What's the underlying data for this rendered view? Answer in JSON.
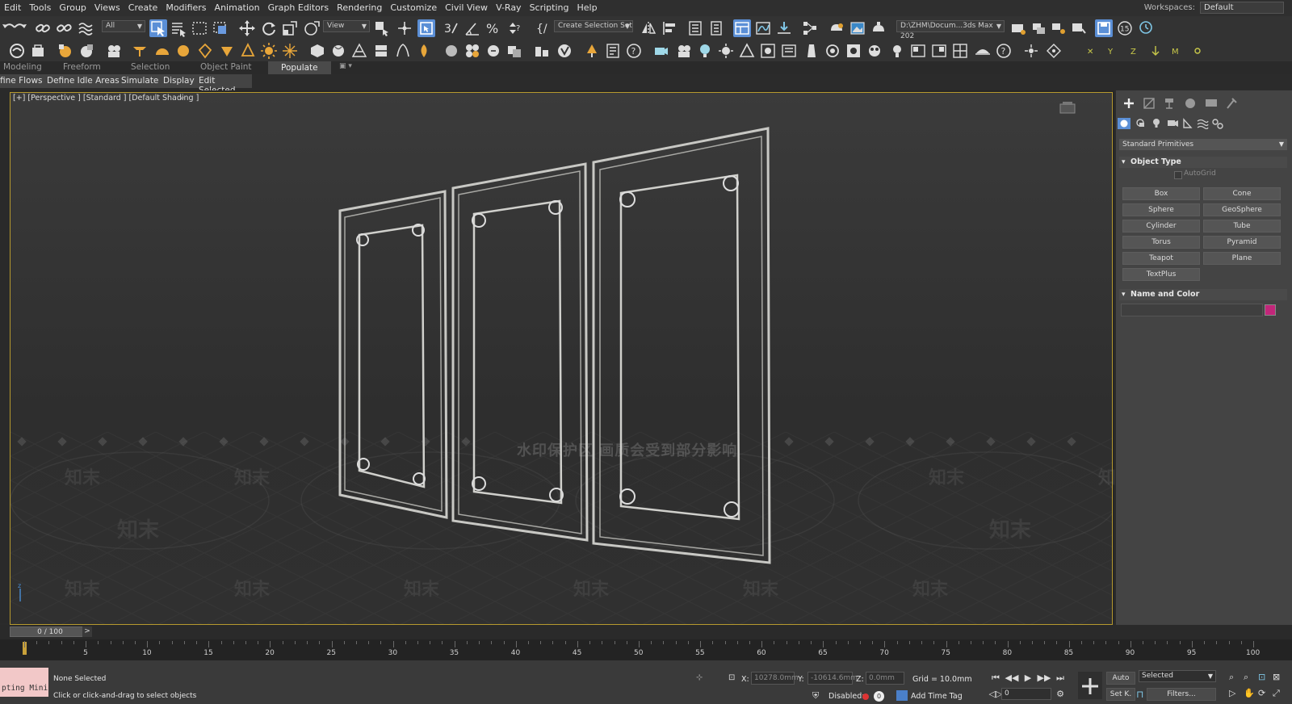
{
  "menu": [
    "Edit",
    "Tools",
    "Group",
    "Views",
    "Create",
    "Modifiers",
    "Animation",
    "Graph Editors",
    "Rendering",
    "Customize",
    "Civil View",
    "V-Ray",
    "Scripting",
    "Help"
  ],
  "workspaces": {
    "label": "Workspaces:",
    "value": "Default"
  },
  "toolbar": {
    "selection_filter": "All",
    "ref_coord": "View",
    "selection_set": "Create Selection Set",
    "project_path": "D:\\ZHM\\Docum...3ds Max 202",
    "snap_counter": "15"
  },
  "ribbon": {
    "tabs": [
      "Modeling",
      "Freeform",
      "Selection",
      "Object Paint",
      "Populate"
    ],
    "active": "Populate",
    "sub_tabs": [
      "fine Flows",
      "Define Idle Areas",
      "Simulate",
      "Display",
      "Edit Selected"
    ]
  },
  "viewport": {
    "label": "[+] [Perspective ] [Standard ] [Default Shading ]"
  },
  "watermark": {
    "line": "水印保护区  画质会受到部分影响",
    "mark": "知末"
  },
  "command_panel": {
    "category": "Standard Primitives",
    "object_type_title": "Object Type",
    "autogrid": "AutoGrid",
    "buttons": [
      "Box",
      "Cone",
      "Sphere",
      "GeoSphere",
      "Cylinder",
      "Tube",
      "Torus",
      "Pyramid",
      "Teapot",
      "Plane",
      "TextPlus"
    ],
    "name_color_title": "Name and Color",
    "color": "#c2267a"
  },
  "timeline": {
    "position": "0 / 100",
    "ticks": [
      "5",
      "10",
      "15",
      "20",
      "25",
      "30",
      "35",
      "40",
      "45",
      "50",
      "55",
      "60",
      "65",
      "70",
      "75",
      "80",
      "85",
      "90",
      "95",
      "100"
    ]
  },
  "status": {
    "maxscript": "pting Mini",
    "line1": "None Selected",
    "line2": "Click or click-and-drag to select objects",
    "x_label": "X:",
    "x_value": "10278.0mm",
    "y_label": "Y:",
    "y_value": "-10614.6mm",
    "z_label": "Z:",
    "z_value": "0.0mm",
    "grid": "Grid = 10.0mm",
    "disabled": "Disabled:",
    "disabled_count": "0",
    "add_time_tag": "Add Time Tag",
    "frame": "0",
    "auto": "Auto",
    "set_key": "Set K.",
    "selected": "Selected",
    "filters": "Filters..."
  }
}
